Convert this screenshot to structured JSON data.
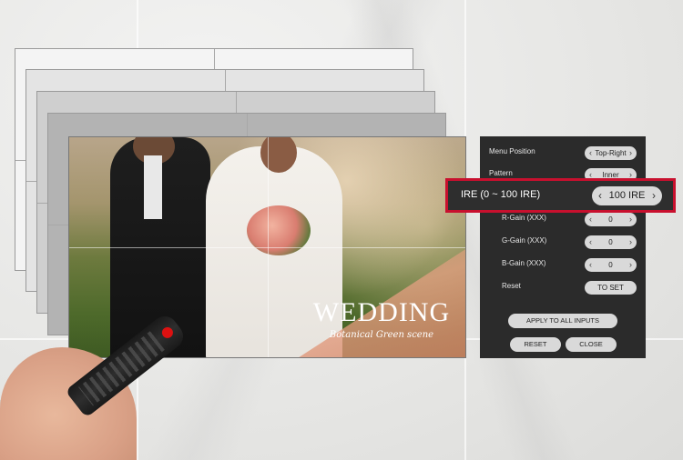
{
  "osd_menu": {
    "rows": [
      {
        "label": "Menu Position",
        "value": "Top-Right"
      },
      {
        "label": "Pattern",
        "value": "Inner"
      },
      {
        "label": "R-Gain (XXX)",
        "value": "0"
      },
      {
        "label": "G-Gain (XXX)",
        "value": "0"
      },
      {
        "label": "B-Gain (XXX)",
        "value": "0"
      },
      {
        "label": "Reset",
        "button": "TO SET"
      }
    ],
    "highlight": {
      "label": "IRE (0 ~ 100 IRE)",
      "value": "100 IRE"
    },
    "apply_all": "APPLY TO ALL INPUTS",
    "reset": "RESET",
    "close": "CLOSE"
  },
  "photo": {
    "title": "WEDDING",
    "subtitle": "Botanical Green scene"
  },
  "colors": {
    "highlight_border": "#c8102e",
    "osd_bg": "#2b2b2b",
    "pill_bg": "#d9d9d9"
  }
}
